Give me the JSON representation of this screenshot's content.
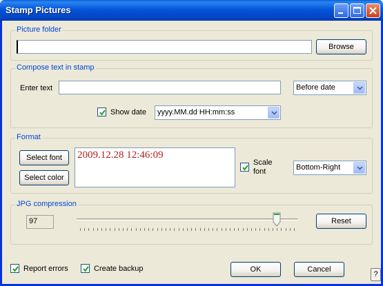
{
  "window": {
    "title": "Stamp Pictures"
  },
  "picture_folder": {
    "legend": "Picture folder",
    "path_value": "",
    "browse_label": "Browse"
  },
  "compose": {
    "legend": "Compose text in stamp",
    "enter_text_label": "Enter text",
    "enter_text_value": "",
    "position_select": "Before date",
    "show_date_label": "Show date",
    "show_date_checked": true,
    "date_format_select": "yyyy.MM.dd HH:mm:ss"
  },
  "format": {
    "legend": "Format",
    "select_font_label": "Select font",
    "select_color_label": "Select color",
    "preview_text": "2009.12.28 12:46:09",
    "preview_color": "#b21f1f",
    "scale_font_label": "Scale font",
    "scale_font_checked": true,
    "placement_select": "Bottom-Right"
  },
  "jpg": {
    "legend": "JPG compression",
    "quality_value": "97",
    "slider_value": 97,
    "slider_min": 0,
    "slider_max": 100,
    "reset_label": "Reset"
  },
  "footer": {
    "report_errors_label": "Report errors",
    "report_errors_checked": true,
    "create_backup_label": "Create backup",
    "create_backup_checked": true,
    "ok_label": "OK",
    "cancel_label": "Cancel",
    "help_label": "?"
  },
  "colors": {
    "titlebar": "#0556d9",
    "legend_text": "#0046d5",
    "checkmark": "#21a121"
  }
}
